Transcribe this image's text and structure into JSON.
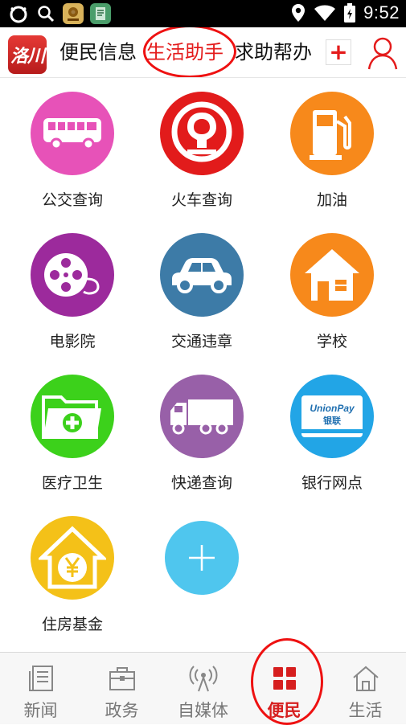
{
  "status_bar": {
    "time": "9:52",
    "icons": [
      "circle-app-icon",
      "search-icon",
      "map-app-icon",
      "notes-app-icon",
      "location-icon",
      "wifi-icon",
      "battery-icon"
    ]
  },
  "header": {
    "logo_text": "洛川",
    "tabs": [
      {
        "label": "便民信息",
        "active": false
      },
      {
        "label": "生活助手",
        "active": true
      },
      {
        "label": "求助帮办",
        "active": false
      }
    ],
    "add_tab_icon": "+",
    "user_icon": "user-icon"
  },
  "services": [
    {
      "label": "公交查询",
      "icon": "bus-icon",
      "color": "#e752b8"
    },
    {
      "label": "火车查询",
      "icon": "railway-icon",
      "color": "#e21b1b"
    },
    {
      "label": "加油",
      "icon": "fuel-pump-icon",
      "color": "#f7891b"
    },
    {
      "label": "电影院",
      "icon": "film-reel-icon",
      "color": "#9c2a9c"
    },
    {
      "label": "交通违章",
      "icon": "car-icon",
      "color": "#3d7ba7"
    },
    {
      "label": "学校",
      "icon": "school-house-icon",
      "color": "#f7891b"
    },
    {
      "label": "医疗卫生",
      "icon": "medical-folder-icon",
      "color": "#3cd11b"
    },
    {
      "label": "快递查询",
      "icon": "truck-icon",
      "color": "#9860a8"
    },
    {
      "label": "银行网点",
      "icon": "unionpay-card-icon",
      "color": "#22a5e6"
    },
    {
      "label": "住房基金",
      "icon": "house-yuan-icon",
      "color": "#f4c118"
    },
    {
      "label": "",
      "icon": "add-icon",
      "color": "#4fc6ee"
    }
  ],
  "card_text": {
    "unionpay": "UnionPay",
    "yinlian": "银联"
  },
  "bottom_nav": [
    {
      "label": "新闻",
      "icon": "newspaper-icon",
      "active": false
    },
    {
      "label": "政务",
      "icon": "briefcase-icon",
      "active": false
    },
    {
      "label": "自媒体",
      "icon": "broadcast-tower-icon",
      "active": false
    },
    {
      "label": "便民",
      "icon": "grid-icon",
      "active": true
    },
    {
      "label": "生活",
      "icon": "home-icon",
      "active": false
    }
  ]
}
